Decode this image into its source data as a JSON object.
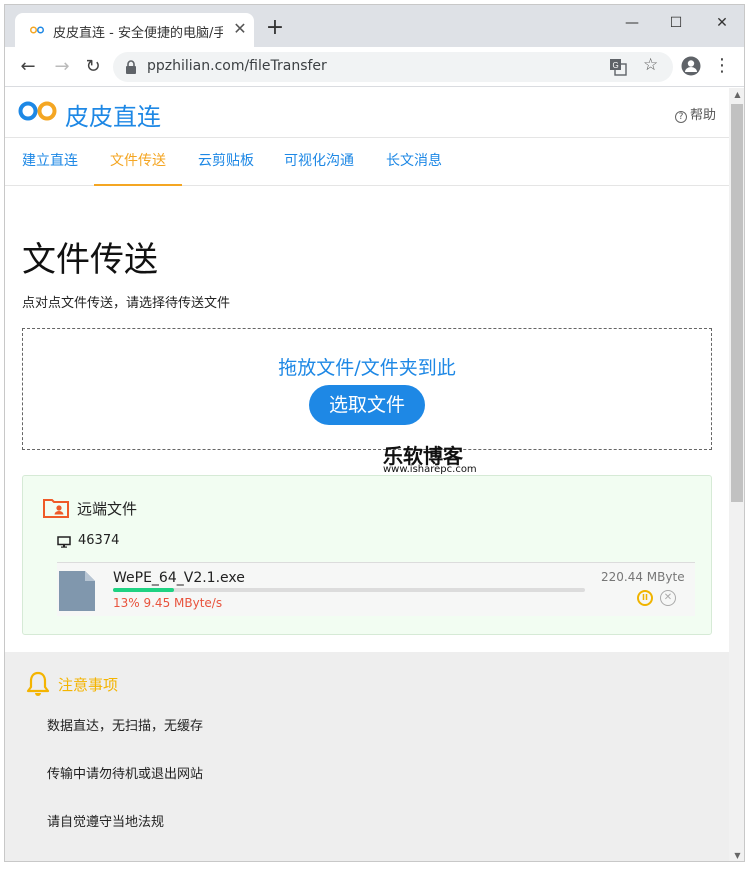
{
  "browser": {
    "tab_title": "皮皮直连 - 安全便捷的电脑/手机",
    "url": "ppzhilian.com/fileTransfer"
  },
  "site": {
    "logo_text": "皮皮直连",
    "help_label": "帮助"
  },
  "nav": {
    "tabs": [
      {
        "label": "建立直连",
        "active": false
      },
      {
        "label": "文件传送",
        "active": true
      },
      {
        "label": "云剪贴板",
        "active": false
      },
      {
        "label": "可视化沟通",
        "active": false
      },
      {
        "label": "长文消息",
        "active": false
      }
    ]
  },
  "main": {
    "title": "文件传送",
    "subtitle": "点对点文件传送，请选择待传送文件",
    "dropzone_text": "拖放文件/文件夹到此",
    "pick_button": "选取文件"
  },
  "watermark": {
    "title": "乐软博客",
    "url": "www.isharepc.com"
  },
  "remote": {
    "title": "远端文件",
    "device_id": "46374",
    "file": {
      "name": "WePE_64_V2.1.exe",
      "size": "220.44 MByte",
      "progress_percent": 13,
      "status": "13% 9.45 MByte/s"
    }
  },
  "notice": {
    "title": "注意事项",
    "items": [
      "数据直达，无扫描，无缓存",
      "传输中请勿待机或退出网站",
      "请自觉遵守当地法规"
    ]
  },
  "colors": {
    "brand_blue": "#1e88e5",
    "active_tab": "#f4a623",
    "progress_green": "#1ed282",
    "speed_red": "#e8533d",
    "notice_yellow": "#f4b400"
  }
}
